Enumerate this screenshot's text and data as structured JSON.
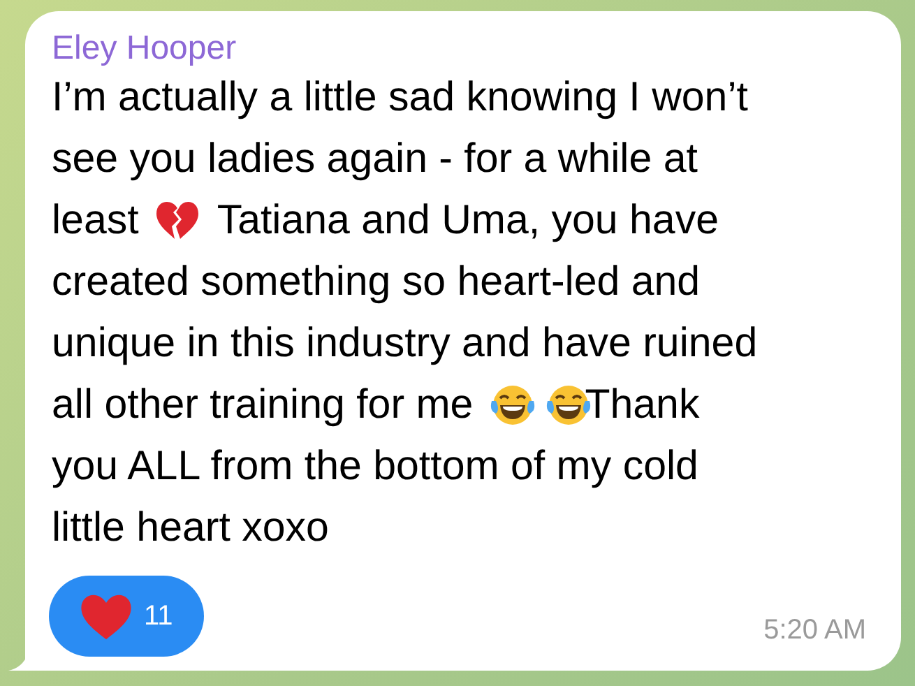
{
  "message": {
    "sender": "Eley Hooper",
    "lines": [
      [
        {
          "kind": "text",
          "text": "I’m actually a little sad knowing I won’t"
        }
      ],
      [
        {
          "kind": "text",
          "text": "see you ladies again - for a while at"
        }
      ],
      [
        {
          "kind": "text",
          "text": "least"
        },
        {
          "kind": "broken-heart"
        },
        {
          "kind": "text",
          "text": "Tatiana and Uma, you have"
        }
      ],
      [
        {
          "kind": "text",
          "text": "created something so heart-led and"
        }
      ],
      [
        {
          "kind": "text",
          "text": "unique in this industry and have ruined"
        }
      ],
      [
        {
          "kind": "text",
          "text": "all other training for me"
        },
        {
          "kind": "laughing-face"
        },
        {
          "kind": "laughing-face"
        },
        {
          "kind": "text",
          "text": "Thank"
        }
      ],
      [
        {
          "kind": "text",
          "text": "you ALL from the bottom of my cold"
        }
      ],
      [
        {
          "kind": "text",
          "text": "little heart xoxo"
        }
      ]
    ],
    "reaction": {
      "count": "11",
      "selected": true
    },
    "time": "5:20 AM"
  }
}
